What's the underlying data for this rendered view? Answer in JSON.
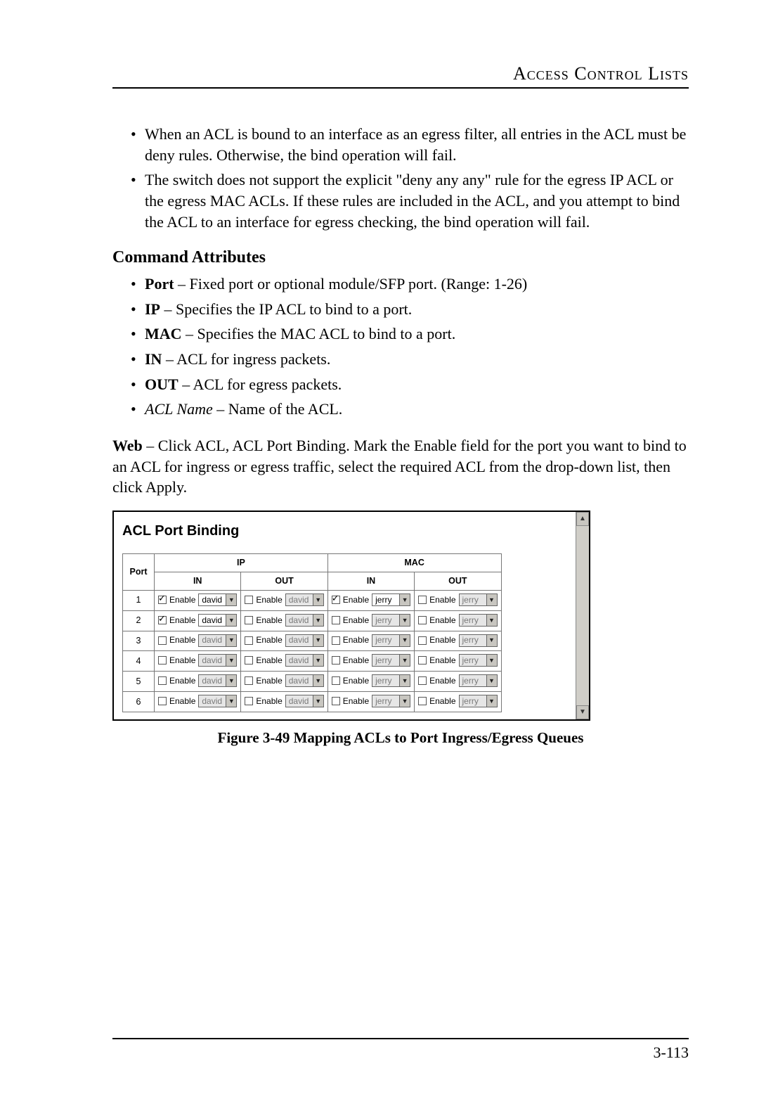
{
  "header": {
    "title": "Access Control Lists"
  },
  "intro_bullets": [
    "When an ACL is bound to an interface as an egress filter, all entries in the ACL must be deny rules. Otherwise, the bind operation will fail.",
    "The switch does not support the explicit \"deny any any\" rule for the egress IP ACL or the egress MAC ACLs. If these rules are included in the ACL, and you attempt to bind the ACL to an interface for egress checking, the bind operation will fail."
  ],
  "section_heading": "Command Attributes",
  "attr_bullets": [
    {
      "term": "Port",
      "desc": " – Fixed port or optional module/SFP port. (Range: 1-26)",
      "italic": false
    },
    {
      "term": "IP",
      "desc": " – Specifies the IP ACL to bind to a port.",
      "italic": false
    },
    {
      "term": "MAC",
      "desc": " – Specifies the MAC ACL to bind to a port.",
      "italic": false
    },
    {
      "term": "IN",
      "desc": " – ACL for ingress packets.",
      "italic": false
    },
    {
      "term": "OUT",
      "desc": " – ACL for egress packets.",
      "italic": false
    },
    {
      "term": "ACL Name",
      "desc": " – Name of the ACL.",
      "italic": true
    }
  ],
  "web_para": {
    "lead": "Web",
    "rest": " – Click ACL, ACL Port Binding. Mark the Enable field for the port you want to bind to an ACL for ingress or egress traffic, select the required ACL from the drop-down list, then click Apply."
  },
  "panel": {
    "title": "ACL Port Binding",
    "headers": {
      "port": "Port",
      "ip": "IP",
      "mac": "MAC",
      "in": "IN",
      "out": "OUT"
    },
    "enable_label": "Enable",
    "ip_acl": "david",
    "mac_acl": "jerry",
    "rows": [
      {
        "port": "1",
        "ip_in_checked": true,
        "ip_out_checked": false,
        "mac_in_checked": true,
        "mac_out_checked": false
      },
      {
        "port": "2",
        "ip_in_checked": true,
        "ip_out_checked": false,
        "mac_in_checked": false,
        "mac_out_checked": false
      },
      {
        "port": "3",
        "ip_in_checked": false,
        "ip_out_checked": false,
        "mac_in_checked": false,
        "mac_out_checked": false
      },
      {
        "port": "4",
        "ip_in_checked": false,
        "ip_out_checked": false,
        "mac_in_checked": false,
        "mac_out_checked": false
      },
      {
        "port": "5",
        "ip_in_checked": false,
        "ip_out_checked": false,
        "mac_in_checked": false,
        "mac_out_checked": false
      },
      {
        "port": "6",
        "ip_in_checked": false,
        "ip_out_checked": false,
        "mac_in_checked": false,
        "mac_out_checked": false
      }
    ]
  },
  "figure_caption": "Figure 3-49  Mapping ACLs to Port Ingress/Egress Queues",
  "page_number": "3-113"
}
